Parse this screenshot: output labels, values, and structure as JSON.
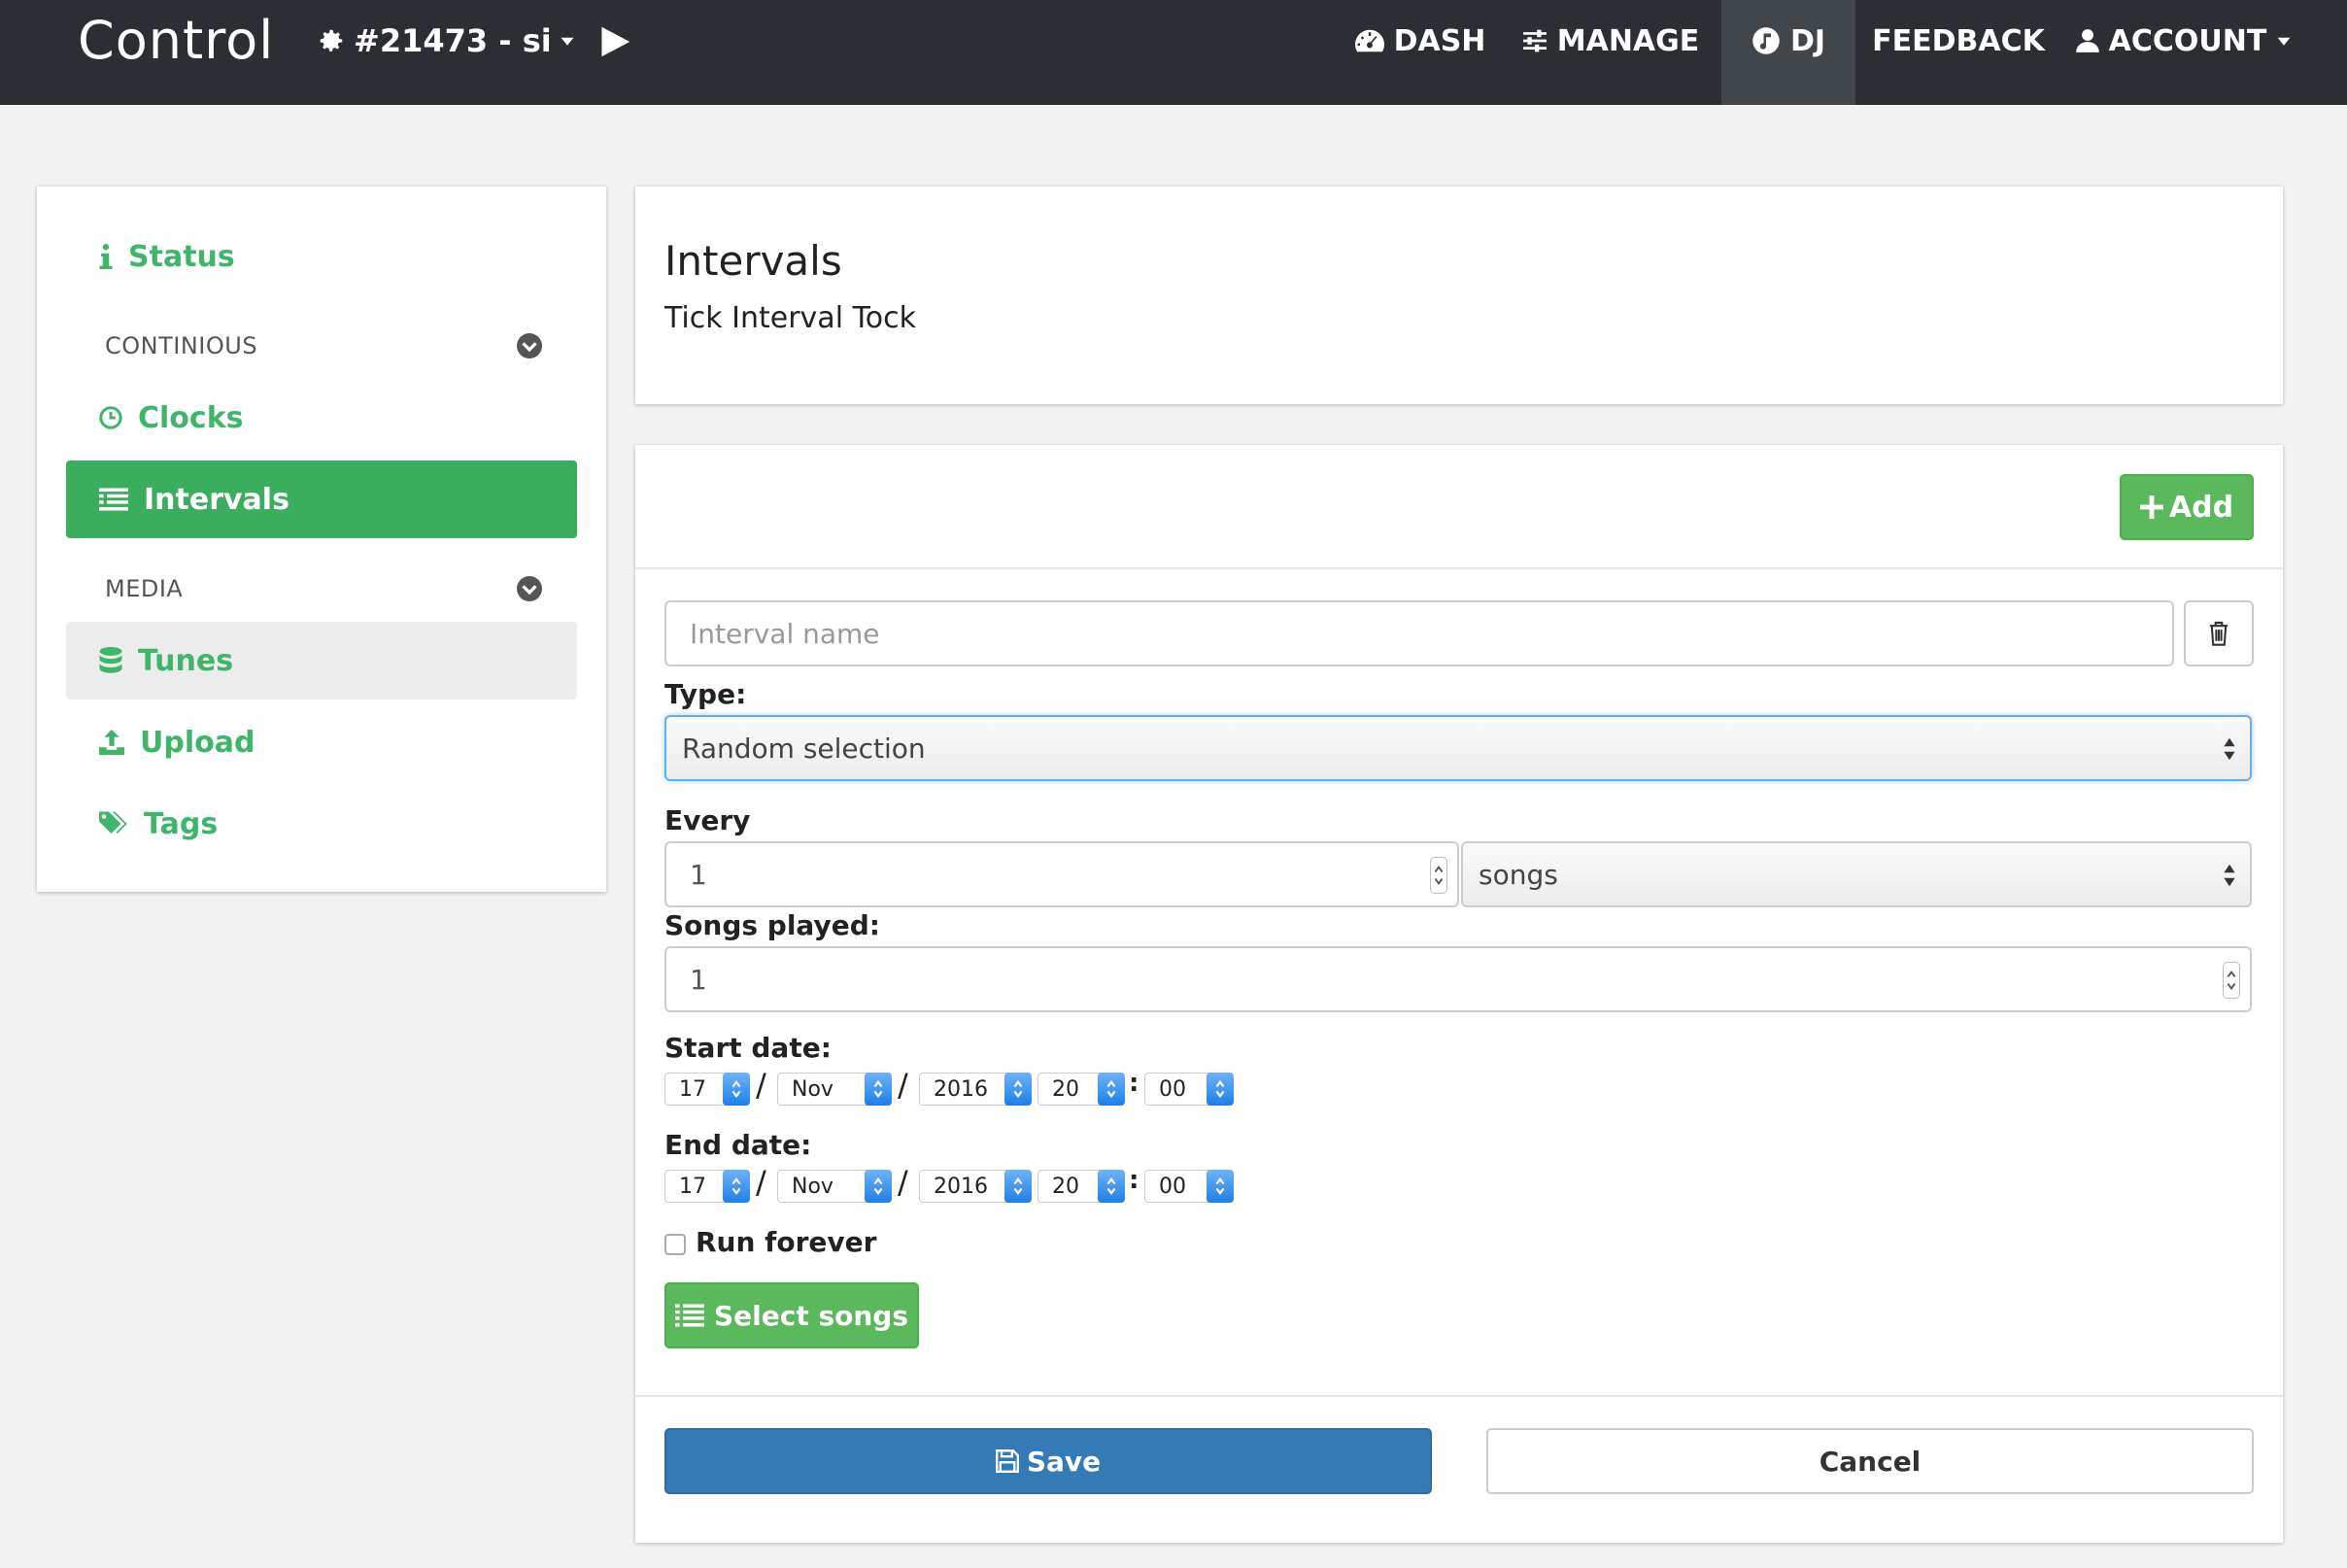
{
  "navbar": {
    "brand": "Control",
    "station": "#21473 - si",
    "items": [
      {
        "label": "DASH",
        "icon": "dashboard-icon"
      },
      {
        "label": "MANAGE",
        "icon": "sliders-icon"
      },
      {
        "label": "DJ",
        "icon": "music-icon",
        "active": true
      },
      {
        "label": "FEEDBACK"
      },
      {
        "label": "ACCOUNT",
        "icon": "user-icon"
      }
    ]
  },
  "sidebar": {
    "status": "Status",
    "continious_header": "CONTINIOUS",
    "clocks": "Clocks",
    "intervals": "Intervals",
    "media_header": "MEDIA",
    "tunes": "Tunes",
    "upload": "Upload",
    "tags": "Tags"
  },
  "header": {
    "title": "Intervals",
    "subtitle": "Tick Interval Tock"
  },
  "form": {
    "add_label": "Add",
    "name_placeholder": "Interval name",
    "type_label": "Type:",
    "type_value": "Random selection",
    "every_label": "Every",
    "every_value": "1",
    "every_unit": "songs",
    "songs_played_label": "Songs played:",
    "songs_played_value": "1",
    "start_label": "Start date:",
    "start": {
      "day": "17",
      "month": "Nov",
      "year": "2016",
      "hour": "20",
      "minute": "00"
    },
    "end_label": "End date:",
    "end": {
      "day": "17",
      "month": "Nov",
      "year": "2016",
      "hour": "20",
      "minute": "00"
    },
    "date_sep": "/",
    "time_sep": ":",
    "run_forever": "Run forever",
    "select_songs": "Select songs",
    "save": "Save",
    "cancel": "Cancel"
  },
  "colors": {
    "navbar_bg": "#2b2f33",
    "accent_green": "#3aad5e",
    "primary_blue": "#337ab7"
  }
}
